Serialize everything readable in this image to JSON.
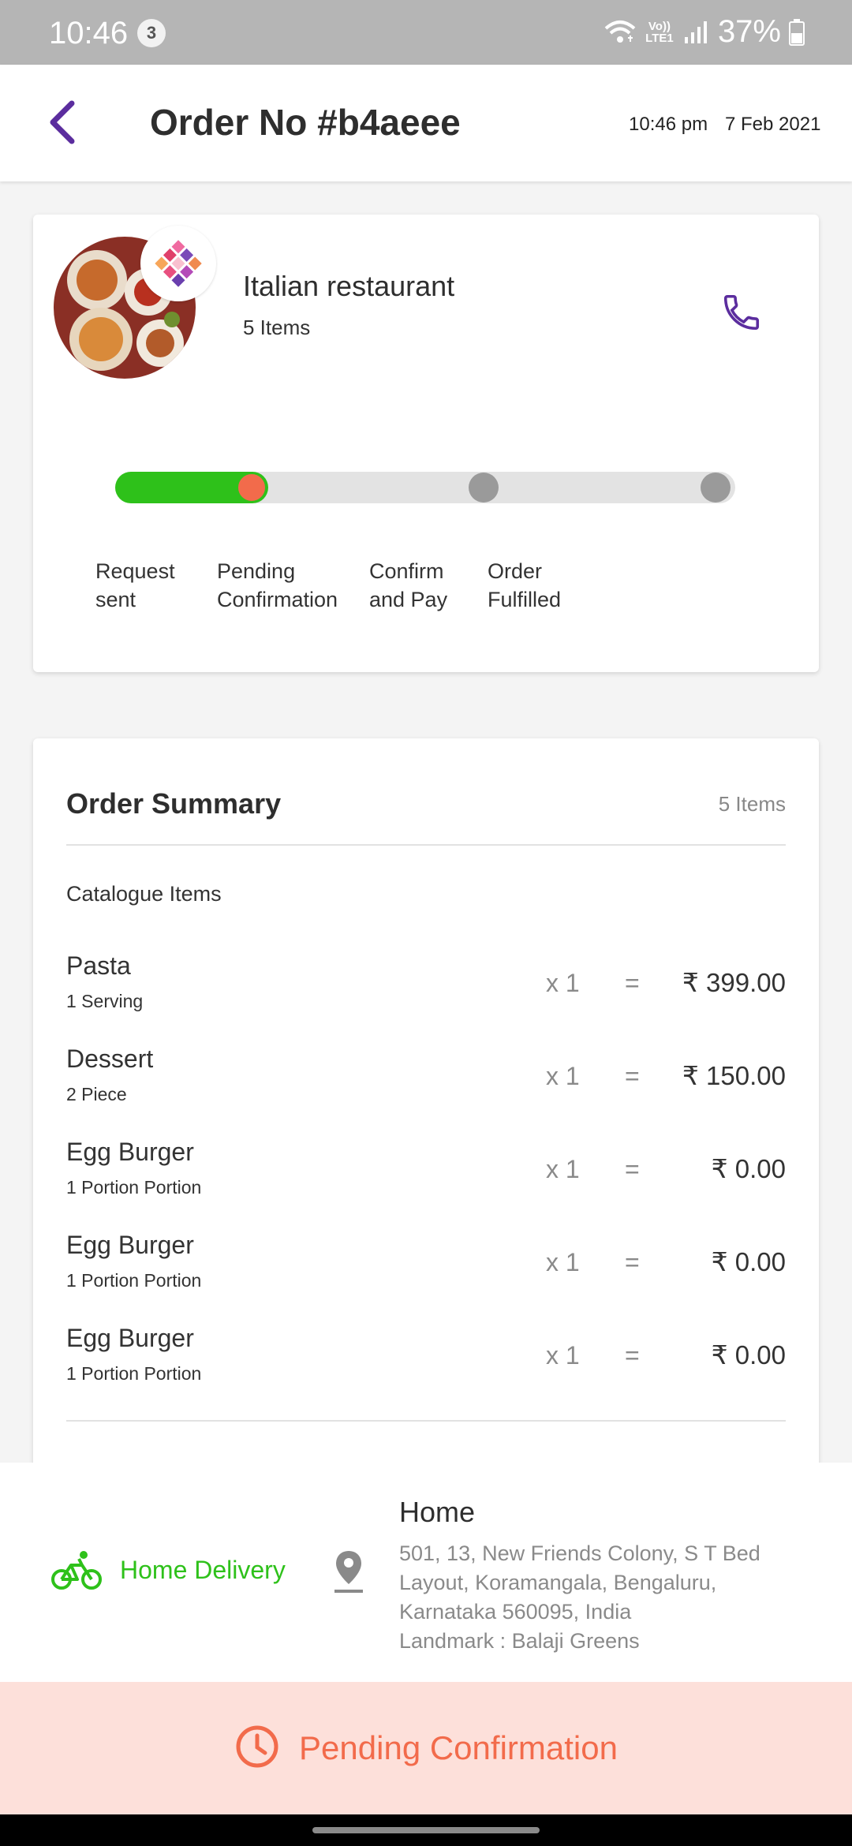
{
  "status_bar": {
    "time": "10:46",
    "notification_count": "3",
    "network": "Vo)) LTE1",
    "battery": "37%"
  },
  "header": {
    "title": "Order No #b4aeee",
    "time": "10:46 pm",
    "date": "7 Feb 2021",
    "accent_color": "#5b2d9e"
  },
  "restaurant": {
    "name": "Italian restaurant",
    "items": "5 Items"
  },
  "progress": {
    "current_step_index": 1,
    "steps": [
      {
        "label": "Request\nsent"
      },
      {
        "label": "Pending\nConfirmation"
      },
      {
        "label": "Confirm\nand Pay"
      },
      {
        "label": "Order\nFulfilled"
      }
    ],
    "done_color": "#2ec11a",
    "current_color": "#f26b4b"
  },
  "summary": {
    "title": "Order Summary",
    "count": "5 Items",
    "section_label": "Catalogue Items",
    "items": [
      {
        "name": "Pasta",
        "unit": "1 Serving",
        "qty": "x 1",
        "eq": "=",
        "price": "₹ 399.00"
      },
      {
        "name": "Dessert",
        "unit": "2 Piece",
        "qty": "x 1",
        "eq": "=",
        "price": "₹ 150.00"
      },
      {
        "name": "Egg Burger",
        "unit": "1 Portion Portion",
        "qty": "x 1",
        "eq": "=",
        "price": "₹ 0.00"
      },
      {
        "name": "Egg Burger",
        "unit": "1 Portion Portion",
        "qty": "x 1",
        "eq": "=",
        "price": "₹ 0.00"
      },
      {
        "name": "Egg Burger",
        "unit": "1 Portion Portion",
        "qty": "x 1",
        "eq": "=",
        "price": "₹ 0.00"
      }
    ]
  },
  "delivery": {
    "mode": "Home Delivery",
    "icon": "bicycle-icon",
    "address_title": "Home",
    "address_lines": [
      "501, 13, New Friends Colony, S T Bed",
      "Layout, Koramangala, Bengaluru,",
      "Karnataka 560095, India",
      "Landmark : Balaji Greens"
    ]
  },
  "footer": {
    "status": "Pending Confirmation",
    "icon": "clock-icon",
    "color": "#f26b4b"
  }
}
